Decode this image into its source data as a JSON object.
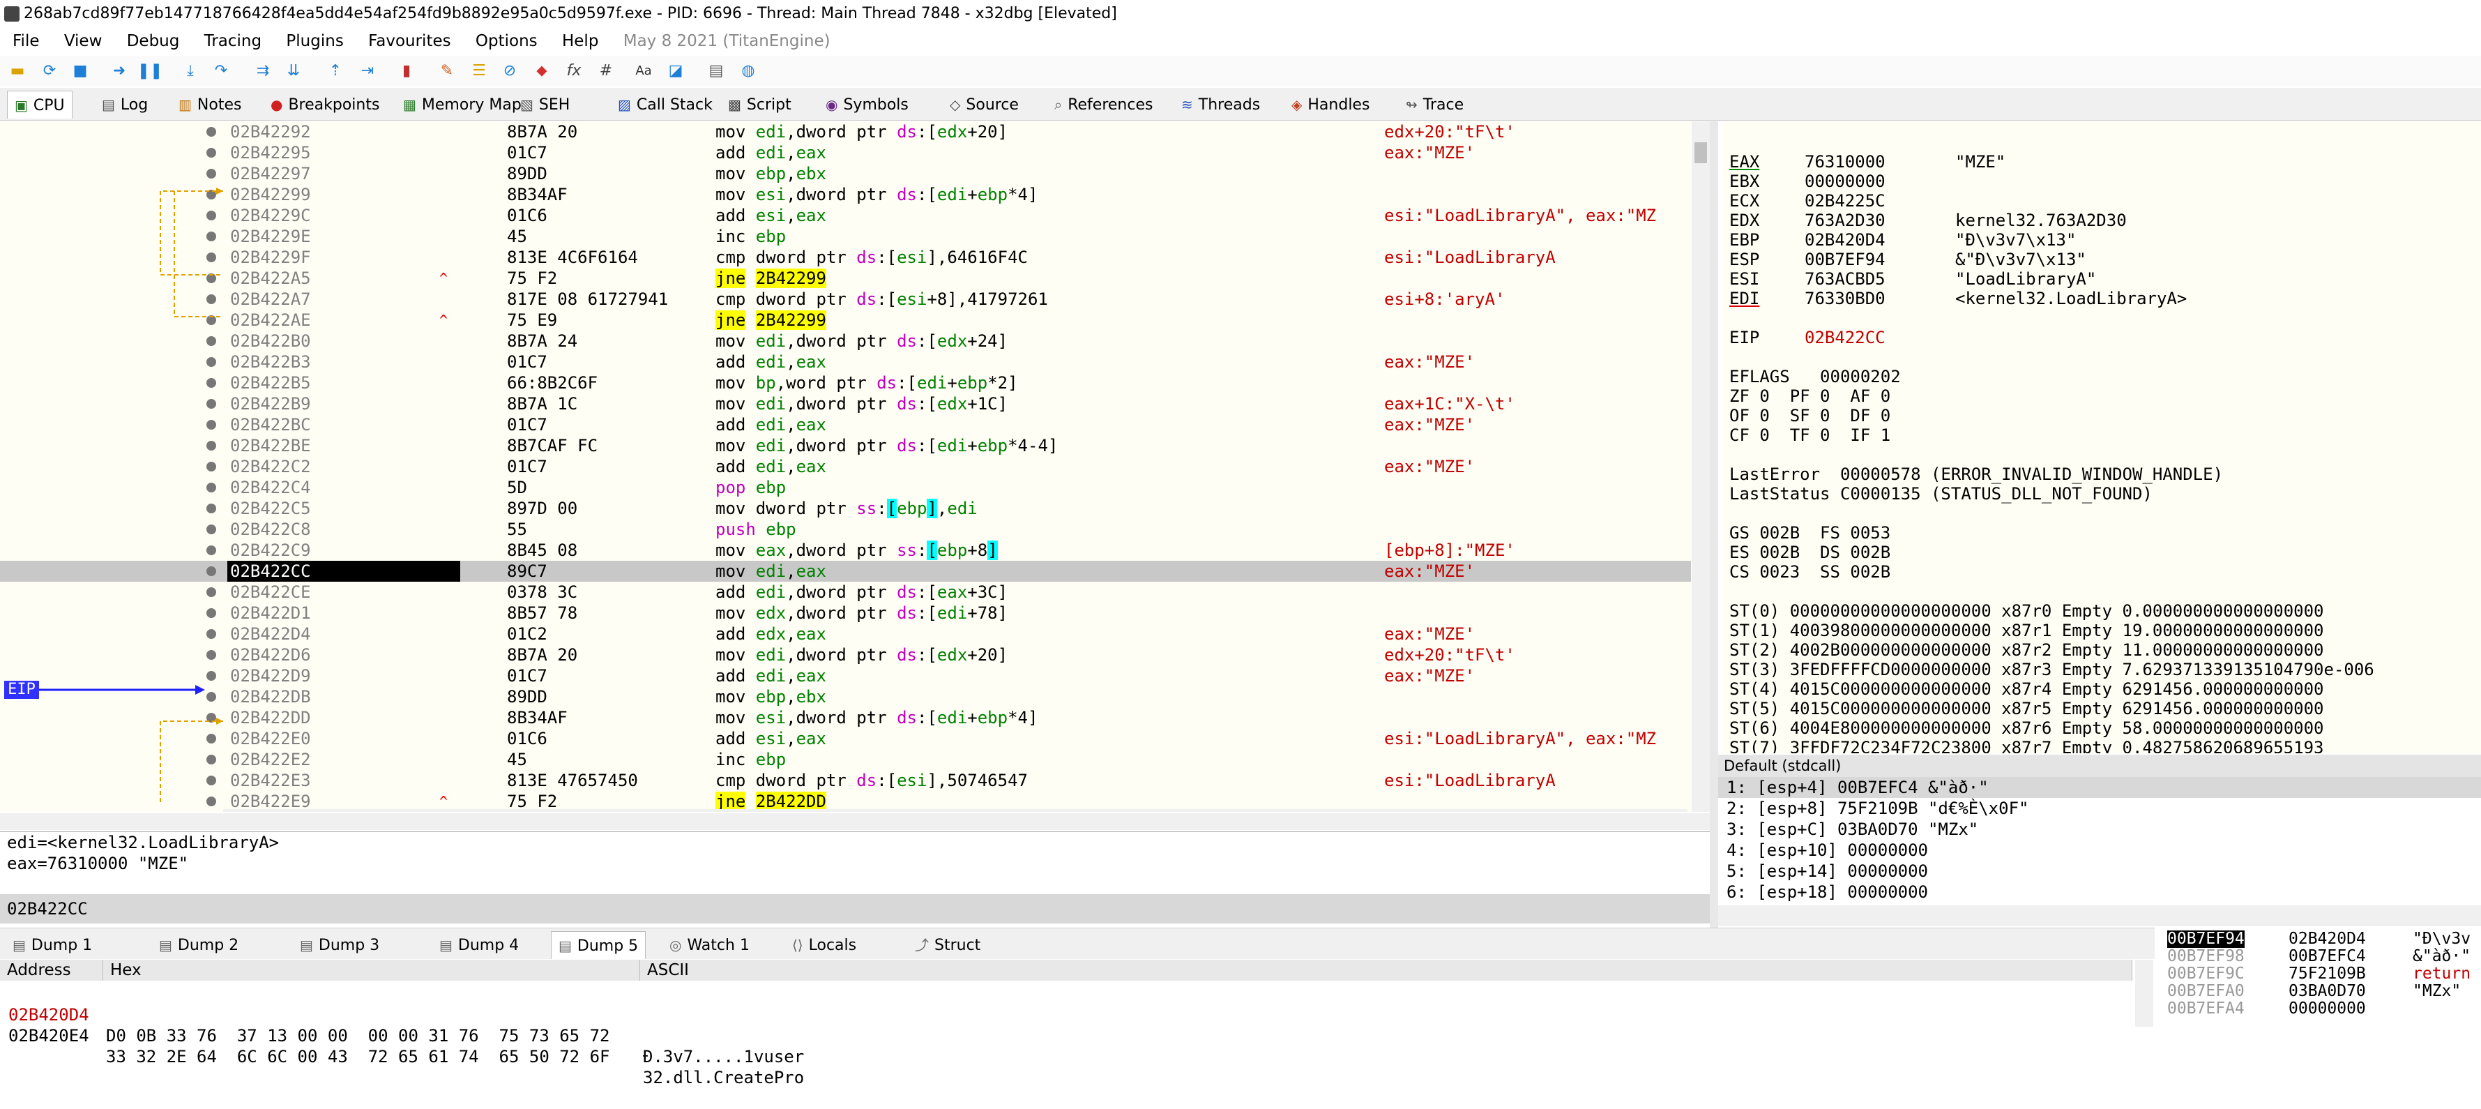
{
  "window": {
    "title": "268ab7cd89f77eb147718766428f4ea5dd4e54af254fd9b8892e95a0c5d9597f.exe - PID: 6696 - Thread: Main Thread 7848 - x32dbg [Elevated]"
  },
  "menu": {
    "items": [
      "File",
      "View",
      "Debug",
      "Tracing",
      "Plugins",
      "Favourites",
      "Options",
      "Help"
    ],
    "info": "May 8 2021 (TitanEngine)"
  },
  "tabs": [
    {
      "label": "CPU",
      "icon": "cpu-icon"
    },
    {
      "label": "Log",
      "icon": "log-icon"
    },
    {
      "label": "Notes",
      "icon": "notes-icon"
    },
    {
      "label": "Breakpoints",
      "icon": "breakpoint-icon"
    },
    {
      "label": "Memory Map",
      "icon": "memory-icon"
    },
    {
      "label": "SEH",
      "icon": "seh-icon"
    },
    {
      "label": "Call Stack",
      "icon": "callstack-icon"
    },
    {
      "label": "Script",
      "icon": "script-icon"
    },
    {
      "label": "Symbols",
      "icon": "symbols-icon"
    },
    {
      "label": "Source",
      "icon": "source-icon"
    },
    {
      "label": "References",
      "icon": "search-icon"
    },
    {
      "label": "Threads",
      "icon": "threads-icon"
    },
    {
      "label": "Handles",
      "icon": "handles-icon"
    },
    {
      "label": "Trace",
      "icon": "trace-icon"
    }
  ],
  "disasm": [
    {
      "addr": "02B42292",
      "bytes": "8B7A 20",
      "parts": [
        [
          "mn",
          "mov "
        ],
        [
          "reg",
          "edi"
        ],
        [
          "",
          ","
        ],
        [
          "",
          "dword ptr "
        ],
        [
          "seg",
          "ds"
        ],
        [
          "",
          ":["
        ],
        [
          "reg",
          "edx"
        ],
        [
          "",
          "+20]"
        ]
      ],
      "cmt": "edx+20:\"tF\\t'"
    },
    {
      "addr": "02B42295",
      "bytes": "01C7",
      "parts": [
        [
          "mn",
          "add "
        ],
        [
          "reg",
          "edi"
        ],
        [
          "",
          ","
        ],
        [
          "reg",
          "eax"
        ]
      ],
      "cmt": "eax:\"MZE'"
    },
    {
      "addr": "02B42297",
      "bytes": "89DD",
      "parts": [
        [
          "mn",
          "mov "
        ],
        [
          "reg",
          "ebp"
        ],
        [
          "",
          ","
        ],
        [
          "reg",
          "ebx"
        ]
      ],
      "cmt": ""
    },
    {
      "addr": "02B42299",
      "bytes": "8B34AF",
      "parts": [
        [
          "mn",
          "mov "
        ],
        [
          "reg",
          "esi"
        ],
        [
          "",
          ",dword ptr "
        ],
        [
          "seg",
          "ds"
        ],
        [
          "",
          ":["
        ],
        [
          "reg",
          "edi"
        ],
        [
          "",
          "+"
        ],
        [
          "reg",
          "ebp"
        ],
        [
          "",
          "*4]"
        ]
      ],
      "cmt": ""
    },
    {
      "addr": "02B4229C",
      "bytes": "01C6",
      "parts": [
        [
          "mn",
          "add "
        ],
        [
          "reg",
          "esi"
        ],
        [
          "",
          ","
        ],
        [
          "reg",
          "eax"
        ]
      ],
      "cmt": "esi:\"LoadLibraryA\", eax:\"MZ"
    },
    {
      "addr": "02B4229E",
      "bytes": "45",
      "parts": [
        [
          "mn",
          "inc "
        ],
        [
          "reg",
          "ebp"
        ]
      ],
      "cmt": ""
    },
    {
      "addr": "02B4229F",
      "bytes": "813E 4C6F6164",
      "parts": [
        [
          "mn",
          "cmp "
        ],
        [
          "",
          "dword ptr "
        ],
        [
          "seg",
          "ds"
        ],
        [
          "",
          ":["
        ],
        [
          "reg",
          "esi"
        ],
        [
          "",
          "],64616F4C"
        ]
      ],
      "cmt": "esi:\"LoadLibraryA"
    },
    {
      "addr": "02B422A5",
      "bytes": "75 F2",
      "mark": "^",
      "parts": [
        [
          "jmp",
          "jne"
        ],
        [
          "",
          " "
        ],
        [
          "jt",
          "2B42299"
        ]
      ],
      "cmt": ""
    },
    {
      "addr": "02B422A7",
      "bytes": "817E 08 61727941",
      "parts": [
        [
          "mn",
          "cmp "
        ],
        [
          "",
          "dword ptr "
        ],
        [
          "seg",
          "ds"
        ],
        [
          "",
          ":["
        ],
        [
          "reg",
          "esi"
        ],
        [
          "",
          "+8],41797261"
        ]
      ],
      "cmt": "esi+8:'aryA'"
    },
    {
      "addr": "02B422AE",
      "bytes": "75 E9",
      "mark": "^",
      "parts": [
        [
          "jmp",
          "jne"
        ],
        [
          "",
          " "
        ],
        [
          "jt",
          "2B42299"
        ]
      ],
      "cmt": ""
    },
    {
      "addr": "02B422B0",
      "bytes": "8B7A 24",
      "parts": [
        [
          "mn",
          "mov "
        ],
        [
          "reg",
          "edi"
        ],
        [
          "",
          ",dword ptr "
        ],
        [
          "seg",
          "ds"
        ],
        [
          "",
          ":["
        ],
        [
          "reg",
          "edx"
        ],
        [
          "",
          "+24]"
        ]
      ],
      "cmt": ""
    },
    {
      "addr": "02B422B3",
      "bytes": "01C7",
      "parts": [
        [
          "mn",
          "add "
        ],
        [
          "reg",
          "edi"
        ],
        [
          "",
          ","
        ],
        [
          "reg",
          "eax"
        ]
      ],
      "cmt": "eax:\"MZE'"
    },
    {
      "addr": "02B422B5",
      "bytes": "66:8B2C6F",
      "parts": [
        [
          "mn",
          "mov "
        ],
        [
          "reg",
          "bp"
        ],
        [
          "",
          ",word ptr "
        ],
        [
          "seg",
          "ds"
        ],
        [
          "",
          ":["
        ],
        [
          "reg",
          "edi"
        ],
        [
          "",
          "+"
        ],
        [
          "reg",
          "ebp"
        ],
        [
          "",
          "*2]"
        ]
      ],
      "cmt": ""
    },
    {
      "addr": "02B422B9",
      "bytes": "8B7A 1C",
      "parts": [
        [
          "mn",
          "mov "
        ],
        [
          "reg",
          "edi"
        ],
        [
          "",
          ",dword ptr "
        ],
        [
          "seg",
          "ds"
        ],
        [
          "",
          ":["
        ],
        [
          "reg",
          "edx"
        ],
        [
          "",
          "+1C]"
        ]
      ],
      "cmt": "eax+1C:\"X-\\t'"
    },
    {
      "addr": "02B422BC",
      "bytes": "01C7",
      "parts": [
        [
          "mn",
          "add "
        ],
        [
          "reg",
          "edi"
        ],
        [
          "",
          ","
        ],
        [
          "reg",
          "eax"
        ]
      ],
      "cmt": "eax:\"MZE'"
    },
    {
      "addr": "02B422BE",
      "bytes": "8B7CAF FC",
      "parts": [
        [
          "mn",
          "mov "
        ],
        [
          "reg",
          "edi"
        ],
        [
          "",
          ",dword ptr "
        ],
        [
          "seg",
          "ds"
        ],
        [
          "",
          ":["
        ],
        [
          "reg",
          "edi"
        ],
        [
          "",
          "+"
        ],
        [
          "reg",
          "ebp"
        ],
        [
          "",
          "*4-4]"
        ]
      ],
      "cmt": ""
    },
    {
      "addr": "02B422C2",
      "bytes": "01C7",
      "parts": [
        [
          "mn",
          "add "
        ],
        [
          "reg",
          "edi"
        ],
        [
          "",
          ","
        ],
        [
          "reg",
          "eax"
        ]
      ],
      "cmt": "eax:\"MZE'"
    },
    {
      "addr": "02B422C4",
      "bytes": "5D",
      "parts": [
        [
          "seg",
          "pop "
        ],
        [
          "reg",
          "ebp"
        ]
      ],
      "cmt": ""
    },
    {
      "addr": "02B422C5",
      "bytes": "897D 00",
      "parts": [
        [
          "mn",
          "mov "
        ],
        [
          "",
          "dword ptr "
        ],
        [
          "seg",
          "ss"
        ],
        [
          "",
          ":"
        ],
        [
          "hl",
          "["
        ],
        [
          "reg",
          "ebp"
        ],
        [
          "hl",
          "]"
        ],
        [
          "",
          ","
        ],
        [
          "reg",
          "edi"
        ]
      ],
      "cmt": ""
    },
    {
      "addr": "02B422C8",
      "bytes": "55",
      "parts": [
        [
          "seg",
          "push "
        ],
        [
          "reg",
          "ebp"
        ]
      ],
      "cmt": ""
    },
    {
      "addr": "02B422C9",
      "bytes": "8B45 08",
      "parts": [
        [
          "mn",
          "mov "
        ],
        [
          "reg",
          "eax"
        ],
        [
          "",
          ",dword ptr "
        ],
        [
          "seg",
          "ss"
        ],
        [
          "",
          ":"
        ],
        [
          "hl",
          "["
        ],
        [
          "reg",
          "ebp"
        ],
        [
          "",
          "+8"
        ],
        [
          "hl",
          "]"
        ]
      ],
      "cmt": "[ebp+8]:\"MZE'"
    },
    {
      "addr": "02B422CC",
      "bytes": "89C7",
      "sel": true,
      "parts": [
        [
          "mn",
          "mov "
        ],
        [
          "reg",
          "edi"
        ],
        [
          "",
          ","
        ],
        [
          "reg",
          "eax"
        ]
      ],
      "cmt": "eax:\"MZE'"
    },
    {
      "addr": "02B422CE",
      "bytes": "0378 3C",
      "parts": [
        [
          "mn",
          "add "
        ],
        [
          "reg",
          "edi"
        ],
        [
          "",
          ",dword ptr "
        ],
        [
          "seg",
          "ds"
        ],
        [
          "",
          ":["
        ],
        [
          "reg",
          "eax"
        ],
        [
          "",
          "+3C]"
        ]
      ],
      "cmt": ""
    },
    {
      "addr": "02B422D1",
      "bytes": "8B57 78",
      "parts": [
        [
          "mn",
          "mov "
        ],
        [
          "reg",
          "edx"
        ],
        [
          "",
          ",dword ptr "
        ],
        [
          "seg",
          "ds"
        ],
        [
          "",
          ":["
        ],
        [
          "reg",
          "edi"
        ],
        [
          "",
          "+78]"
        ]
      ],
      "cmt": ""
    },
    {
      "addr": "02B422D4",
      "bytes": "01C2",
      "parts": [
        [
          "mn",
          "add "
        ],
        [
          "reg",
          "edx"
        ],
        [
          "",
          ","
        ],
        [
          "reg",
          "eax"
        ]
      ],
      "cmt": "eax:\"MZE'"
    },
    {
      "addr": "02B422D6",
      "bytes": "8B7A 20",
      "parts": [
        [
          "mn",
          "mov "
        ],
        [
          "reg",
          "edi"
        ],
        [
          "",
          ",dword ptr "
        ],
        [
          "seg",
          "ds"
        ],
        [
          "",
          ":["
        ],
        [
          "reg",
          "edx"
        ],
        [
          "",
          "+20]"
        ]
      ],
      "cmt": "edx+20:\"tF\\t'"
    },
    {
      "addr": "02B422D9",
      "bytes": "01C7",
      "parts": [
        [
          "mn",
          "add "
        ],
        [
          "reg",
          "edi"
        ],
        [
          "",
          ","
        ],
        [
          "reg",
          "eax"
        ]
      ],
      "cmt": "eax:\"MZE'"
    },
    {
      "addr": "02B422DB",
      "bytes": "89DD",
      "parts": [
        [
          "mn",
          "mov "
        ],
        [
          "reg",
          "ebp"
        ],
        [
          "",
          ","
        ],
        [
          "reg",
          "ebx"
        ]
      ],
      "cmt": ""
    },
    {
      "addr": "02B422DD",
      "bytes": "8B34AF",
      "parts": [
        [
          "mn",
          "mov "
        ],
        [
          "reg",
          "esi"
        ],
        [
          "",
          ",dword ptr "
        ],
        [
          "seg",
          "ds"
        ],
        [
          "",
          ":["
        ],
        [
          "reg",
          "edi"
        ],
        [
          "",
          "+"
        ],
        [
          "reg",
          "ebp"
        ],
        [
          "",
          "*4]"
        ]
      ],
      "cmt": ""
    },
    {
      "addr": "02B422E0",
      "bytes": "01C6",
      "parts": [
        [
          "mn",
          "add "
        ],
        [
          "reg",
          "esi"
        ],
        [
          "",
          ","
        ],
        [
          "reg",
          "eax"
        ]
      ],
      "cmt": "esi:\"LoadLibraryA\", eax:\"MZ"
    },
    {
      "addr": "02B422E2",
      "bytes": "45",
      "parts": [
        [
          "mn",
          "inc "
        ],
        [
          "reg",
          "ebp"
        ]
      ],
      "cmt": ""
    },
    {
      "addr": "02B422E3",
      "bytes": "813E 47657450",
      "parts": [
        [
          "mn",
          "cmp "
        ],
        [
          "",
          "dword ptr "
        ],
        [
          "seg",
          "ds"
        ],
        [
          "",
          ":["
        ],
        [
          "reg",
          "esi"
        ],
        [
          "",
          "],50746547"
        ]
      ],
      "cmt": "esi:\"LoadLibraryA"
    },
    {
      "addr": "02B422E9",
      "bytes": "75 F2",
      "mark": "^",
      "parts": [
        [
          "jmp",
          "jne"
        ],
        [
          "",
          " "
        ],
        [
          "jt",
          "2B422DD"
        ]
      ],
      "cmt": ""
    }
  ],
  "eip_label": "EIP",
  "info": {
    "line1": "edi=<kernel32.LoadLibraryA>",
    "line2": "eax=76310000 \"MZE\"",
    "address": "02B422CC"
  },
  "registers": {
    "gp": [
      {
        "name": "EAX",
        "value": "76310000",
        "comment": "\"MZE\"",
        "ul": "green"
      },
      {
        "name": "EBX",
        "value": "00000000",
        "comment": ""
      },
      {
        "name": "ECX",
        "value": "02B4225C",
        "comment": ""
      },
      {
        "name": "EDX",
        "value": "763A2D30",
        "comment": "kernel32.763A2D30"
      },
      {
        "name": "EBP",
        "value": "02B420D4",
        "comment": "\"Ð\\v3v7\\x13\""
      },
      {
        "name": "ESP",
        "value": "00B7EF94",
        "comment": "&\"Ð\\v3v7\\x13\""
      },
      {
        "name": "ESI",
        "value": "763ACBD5",
        "comment": "\"LoadLibraryA\""
      },
      {
        "name": "EDI",
        "value": "76330BD0",
        "comment": "<kernel32.LoadLibraryA>",
        "ul": "red"
      }
    ],
    "eip": {
      "name": "EIP",
      "value": "02B422CC"
    },
    "eflags": "EFLAGS   00000202",
    "flags": [
      "ZF 0  PF 0  AF 0",
      "OF 0  SF 0  DF 0",
      "CF 0  TF 0  IF 1"
    ],
    "lasterror": "LastError  00000578 (ERROR_INVALID_WINDOW_HANDLE)",
    "laststatus": "LastStatus C0000135 (STATUS_DLL_NOT_FOUND)",
    "segs": [
      "GS 002B  FS 0053",
      "ES 002B  DS 002B",
      "CS 0023  SS 002B"
    ],
    "fpu": [
      "ST(0) 00000000000000000000 x87r0 Empty 0.000000000000000000",
      "ST(1) 40039800000000000000 x87r1 Empty 19.00000000000000000",
      "ST(2) 4002B000000000000000 x87r2 Empty 11.00000000000000000",
      "ST(3) 3FEDFFFFCD0000000000 x87r3 Empty 7.629371339135104790e-006",
      "ST(4) 4015C000000000000000 x87r4 Empty 6291456.000000000000",
      "ST(5) 4015C000000000000000 x87r5 Empty 6291456.000000000000",
      "ST(6) 4004E800000000000000 x87r6 Empty 58.00000000000000000",
      "ST(7) 3FFDF72C234F72C23800 x87r7 Empty 0.482758620689655193"
    ]
  },
  "callconv": "Default (stdcall)",
  "stackargs": [
    "1: [esp+4] 00B7EFC4 &\"àð·\"",
    "2: [esp+8] 75F2109B \"d€%È\\x0F\"",
    "3: [esp+C] 03BA0D70 \"MZx\"",
    "4: [esp+10] 00000000",
    "5: [esp+14] 00000000",
    "6: [esp+18] 00000000"
  ],
  "dumptabs": [
    {
      "label": "Dump 1",
      "icon": "dump-icon"
    },
    {
      "label": "Dump 2",
      "icon": "dump-icon"
    },
    {
      "label": "Dump 3",
      "icon": "dump-icon"
    },
    {
      "label": "Dump 4",
      "icon": "dump-icon"
    },
    {
      "label": "Dump 5",
      "icon": "dump-icon",
      "active": true
    },
    {
      "label": "Watch 1",
      "icon": "watch-icon"
    },
    {
      "label": "Locals",
      "icon": "locals-icon"
    },
    {
      "label": "Struct",
      "icon": "struct-icon"
    }
  ],
  "dump": {
    "headers": [
      "Address",
      "Hex",
      "ASCII"
    ],
    "rows": [
      {
        "addr": "02B420D4",
        "hex": "D0 0B 33 76  37 13 00 00  00 00 31 76  75 73 65 72",
        "ascii": "Ð.3v7.....1vuser"
      },
      {
        "addr": "02B420E4",
        "hex": "33 32 2E 64  6C 6C 00 43  72 65 61 74  65 50 72 6F",
        "ascii": "32.dll.CreatePro"
      }
    ]
  },
  "stack": [
    {
      "addr": "00B7EF94",
      "val": "02B420D4",
      "cmt": "\"Ð\\v3v"
    },
    {
      "addr": "00B7EF98",
      "val": "00B7EFC4",
      "cmt": "&\"àð·\""
    },
    {
      "addr": "00B7EF9C",
      "val": "75F2109B",
      "cmt": "return"
    },
    {
      "addr": "00B7EFA0",
      "val": "03BA0D70",
      "cmt": "\"MZx\""
    },
    {
      "addr": "00B7EFA4",
      "val": "00000000",
      "cmt": ""
    }
  ]
}
